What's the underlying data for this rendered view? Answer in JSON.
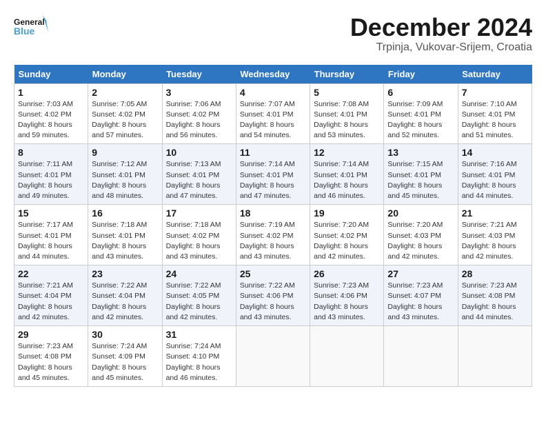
{
  "header": {
    "logo_general": "General",
    "logo_blue": "Blue",
    "month_title": "December 2024",
    "location": "Trpinja, Vukovar-Srijem, Croatia"
  },
  "days_of_week": [
    "Sunday",
    "Monday",
    "Tuesday",
    "Wednesday",
    "Thursday",
    "Friday",
    "Saturday"
  ],
  "weeks": [
    [
      {
        "day": "1",
        "info": "Sunrise: 7:03 AM\nSunset: 4:02 PM\nDaylight: 8 hours and 59 minutes."
      },
      {
        "day": "2",
        "info": "Sunrise: 7:05 AM\nSunset: 4:02 PM\nDaylight: 8 hours and 57 minutes."
      },
      {
        "day": "3",
        "info": "Sunrise: 7:06 AM\nSunset: 4:02 PM\nDaylight: 8 hours and 56 minutes."
      },
      {
        "day": "4",
        "info": "Sunrise: 7:07 AM\nSunset: 4:01 PM\nDaylight: 8 hours and 54 minutes."
      },
      {
        "day": "5",
        "info": "Sunrise: 7:08 AM\nSunset: 4:01 PM\nDaylight: 8 hours and 53 minutes."
      },
      {
        "day": "6",
        "info": "Sunrise: 7:09 AM\nSunset: 4:01 PM\nDaylight: 8 hours and 52 minutes."
      },
      {
        "day": "7",
        "info": "Sunrise: 7:10 AM\nSunset: 4:01 PM\nDaylight: 8 hours and 51 minutes."
      }
    ],
    [
      {
        "day": "8",
        "info": "Sunrise: 7:11 AM\nSunset: 4:01 PM\nDaylight: 8 hours and 49 minutes."
      },
      {
        "day": "9",
        "info": "Sunrise: 7:12 AM\nSunset: 4:01 PM\nDaylight: 8 hours and 48 minutes."
      },
      {
        "day": "10",
        "info": "Sunrise: 7:13 AM\nSunset: 4:01 PM\nDaylight: 8 hours and 47 minutes."
      },
      {
        "day": "11",
        "info": "Sunrise: 7:14 AM\nSunset: 4:01 PM\nDaylight: 8 hours and 47 minutes."
      },
      {
        "day": "12",
        "info": "Sunrise: 7:14 AM\nSunset: 4:01 PM\nDaylight: 8 hours and 46 minutes."
      },
      {
        "day": "13",
        "info": "Sunrise: 7:15 AM\nSunset: 4:01 PM\nDaylight: 8 hours and 45 minutes."
      },
      {
        "day": "14",
        "info": "Sunrise: 7:16 AM\nSunset: 4:01 PM\nDaylight: 8 hours and 44 minutes."
      }
    ],
    [
      {
        "day": "15",
        "info": "Sunrise: 7:17 AM\nSunset: 4:01 PM\nDaylight: 8 hours and 44 minutes."
      },
      {
        "day": "16",
        "info": "Sunrise: 7:18 AM\nSunset: 4:01 PM\nDaylight: 8 hours and 43 minutes."
      },
      {
        "day": "17",
        "info": "Sunrise: 7:18 AM\nSunset: 4:02 PM\nDaylight: 8 hours and 43 minutes."
      },
      {
        "day": "18",
        "info": "Sunrise: 7:19 AM\nSunset: 4:02 PM\nDaylight: 8 hours and 43 minutes."
      },
      {
        "day": "19",
        "info": "Sunrise: 7:20 AM\nSunset: 4:02 PM\nDaylight: 8 hours and 42 minutes."
      },
      {
        "day": "20",
        "info": "Sunrise: 7:20 AM\nSunset: 4:03 PM\nDaylight: 8 hours and 42 minutes."
      },
      {
        "day": "21",
        "info": "Sunrise: 7:21 AM\nSunset: 4:03 PM\nDaylight: 8 hours and 42 minutes."
      }
    ],
    [
      {
        "day": "22",
        "info": "Sunrise: 7:21 AM\nSunset: 4:04 PM\nDaylight: 8 hours and 42 minutes."
      },
      {
        "day": "23",
        "info": "Sunrise: 7:22 AM\nSunset: 4:04 PM\nDaylight: 8 hours and 42 minutes."
      },
      {
        "day": "24",
        "info": "Sunrise: 7:22 AM\nSunset: 4:05 PM\nDaylight: 8 hours and 42 minutes."
      },
      {
        "day": "25",
        "info": "Sunrise: 7:22 AM\nSunset: 4:06 PM\nDaylight: 8 hours and 43 minutes."
      },
      {
        "day": "26",
        "info": "Sunrise: 7:23 AM\nSunset: 4:06 PM\nDaylight: 8 hours and 43 minutes."
      },
      {
        "day": "27",
        "info": "Sunrise: 7:23 AM\nSunset: 4:07 PM\nDaylight: 8 hours and 43 minutes."
      },
      {
        "day": "28",
        "info": "Sunrise: 7:23 AM\nSunset: 4:08 PM\nDaylight: 8 hours and 44 minutes."
      }
    ],
    [
      {
        "day": "29",
        "info": "Sunrise: 7:23 AM\nSunset: 4:08 PM\nDaylight: 8 hours and 45 minutes."
      },
      {
        "day": "30",
        "info": "Sunrise: 7:24 AM\nSunset: 4:09 PM\nDaylight: 8 hours and 45 minutes."
      },
      {
        "day": "31",
        "info": "Sunrise: 7:24 AM\nSunset: 4:10 PM\nDaylight: 8 hours and 46 minutes."
      },
      null,
      null,
      null,
      null
    ]
  ]
}
